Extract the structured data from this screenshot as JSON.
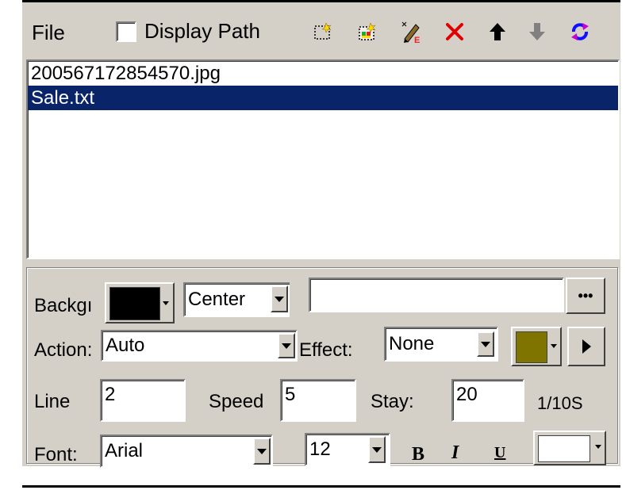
{
  "toolbar": {
    "file_label": "File",
    "display_path_label": "Display Path",
    "display_path_checked": false,
    "icons": [
      "new-file-icon",
      "open-program-icon",
      "edit-icon",
      "delete-icon",
      "move-up-icon",
      "move-down-icon",
      "refresh-icon"
    ]
  },
  "file_list": {
    "items": [
      {
        "name": "200567172854570.jpg",
        "selected": false
      },
      {
        "name": "Sale.txt",
        "selected": true
      }
    ]
  },
  "properties": {
    "background_label": "Backgı",
    "background_color": "#000000",
    "align_value": "Center",
    "path_value": "",
    "browse_label": "•••",
    "action_label": "Action:",
    "action_value": "Auto",
    "effect_label": "Effect:",
    "effect_value": "None",
    "effect_color": "#7f7400",
    "line_label": "Line",
    "line_value": "2",
    "speed_label": "Speed",
    "speed_value": "5",
    "stay_label": "Stay:",
    "stay_value": "20",
    "stay_unit": "1/10S",
    "font_label": "Font:",
    "font_value": "Arial",
    "font_size_value": "12",
    "bold_label": "B",
    "italic_label": "I",
    "underline_label": "U",
    "font_color": "#ffffff"
  },
  "colors": {
    "panel_bg": "#d4d0c8",
    "selection_bg": "#0a246a",
    "delete_red": "#e00000",
    "refresh_blue": "#1010ff"
  }
}
